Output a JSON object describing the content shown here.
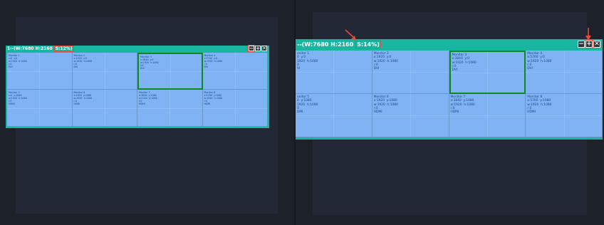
{
  "colors": {
    "canvas_border": "#18b6a1",
    "monitor_fill": "#7fb3f4",
    "selection": "#0b8a1e",
    "highlight": "#e54b3a"
  },
  "left_panel": {
    "title_prefix": "1--(W:7680 H:2160 ",
    "scale": "S:12%)",
    "buttons": {
      "minus": "−",
      "plus": "+",
      "close": "✕"
    },
    "monitors": [
      {
        "id": "m1",
        "text": "Monitor 1\nx:0  y:0\nw:1920  h:1080\nr:0\nDVI"
      },
      {
        "id": "m2",
        "text": "Monitor 2\nx:1920  y:0\nw:1920  h:1080\nr:0\nDVI"
      },
      {
        "id": "m3",
        "text": "Monitor 3\nx:3840  y:0\nw:1920  h:1080\nr:0\nDVI"
      },
      {
        "id": "m4",
        "text": "Monitor 4\nx:5760  y:0\nw:1920  h:1080\nr:0\nDVI"
      },
      {
        "id": "m5",
        "text": "Monitor 5\nx:0  y:1080\nw:1920  h:1080\nr:0\nHDMI"
      },
      {
        "id": "m6",
        "text": "Monitor 6\nx:1920  y:1080\nw:1920  h:1080\nr:0\nHDMI"
      },
      {
        "id": "m7",
        "text": "Monitor 7\nx:3840  y:1080\nw:1920  h:1080\nr:0\nHDMI"
      },
      {
        "id": "m8",
        "text": "Monitor 8\nx:5760  y:1080\nw:1920  h:1080\nr:0\nHDMI"
      }
    ]
  },
  "right_panel": {
    "title_prefix": "--(W:7680 H:2160 ",
    "scale": "S:14%)",
    "buttons": {
      "minus": "−",
      "plus": "+",
      "close": "✕"
    },
    "monitors": [
      {
        "id": "m1",
        "text": "onitor 1\n0  y:0\n1920  h:1080\n0\nVI"
      },
      {
        "id": "m2",
        "text": "Monitor 2\nx:1920  y:0\nw:1920  h:1080\nr:0\nDVI"
      },
      {
        "id": "m3",
        "text": "Monitor 3\nx:3840  y:0\nw:1920  h:1080\nr:0\nDVI"
      },
      {
        "id": "m4",
        "text": "Monitor 4\nx:5760  y:0\nw:1920  h:1080\nr:0\nDVI"
      },
      {
        "id": "m5",
        "text": "onitor 5\n0  y:1080\n1920  h:1080\n0\nDMI"
      },
      {
        "id": "m6",
        "text": "Monitor 6\nx:1920  y:1080\nw:1920  h:1080\nr:0\nHDMI"
      },
      {
        "id": "m7",
        "text": "Monitor 7\nx:3840  y:1080\nw:1920  h:1080\nr:0\nHDMI"
      },
      {
        "id": "m8",
        "text": "Monitor 8\nx:5760  y:1080\nw:1920  h:1080\nr:0\nHDMI"
      }
    ]
  }
}
